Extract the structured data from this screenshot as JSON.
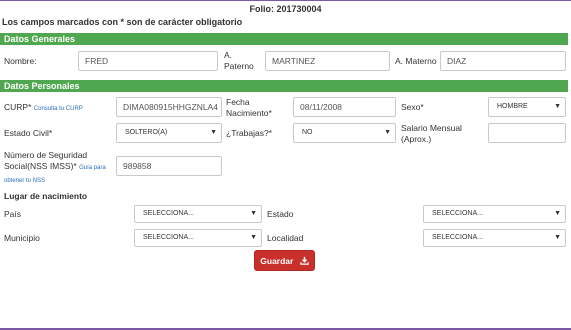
{
  "header": {
    "folio": "Folio: 201730004",
    "mandatory_note": "Los campos marcados con * son de carácter obligatorio"
  },
  "datos_generales": {
    "title": "Datos Generales",
    "nombre_label": "Nombre:",
    "nombre_value": "FRED",
    "paterno_label_1": "A.",
    "paterno_label_2": "Paterno",
    "paterno_value": "MARTINEZ",
    "materno_label": "A. Materno",
    "materno_value": "DIAZ"
  },
  "datos_personales": {
    "title": "Datos Personales",
    "curp_label": "CURP*",
    "curp_link": "Consulta tu CURP",
    "curp_value": "DIMA080915HHGZNLA4",
    "fecha_label_1": "Fecha",
    "fecha_label_2": "Nacimiento*",
    "fecha_value": "08/11/2008",
    "sexo_label": "Sexo*",
    "sexo_value": "HOMBRE",
    "estado_civil_label": "Estado Civil*",
    "estado_civil_value": "SOLTERO(A)",
    "trabajas_label": "¿Trabajas?*",
    "trabajas_value": "NO",
    "salario_label_1": "Salario Mensual",
    "salario_label_2": "(Aprox.)",
    "salario_value": "",
    "nss_label_1": "Número de Seguridad",
    "nss_label_2": "Social(NSS IMSS)*",
    "nss_link_1": "Guía para",
    "nss_link_2": "obtener tu NSS",
    "nss_value": "989858"
  },
  "lugar_nacimiento": {
    "title": "Lugar de nacimiento",
    "pais_label": "País",
    "pais_value": "SELECCIONA...",
    "estado_label": "Estado",
    "estado_value": "SELECCIONA...",
    "municipio_label": "Municipio",
    "municipio_value": "SELECCIONA...",
    "localidad_label": "Localidad",
    "localidad_value": "SELECCIONA..."
  },
  "actions": {
    "guardar_label": "Guardar"
  },
  "colors": {
    "section_green": "#4fa84f",
    "button_red": "#c9302c",
    "border_purple": "#7a5aa6"
  }
}
